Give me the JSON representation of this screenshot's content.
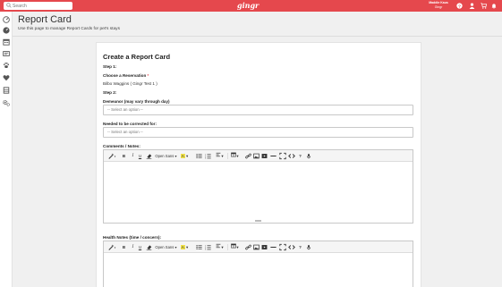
{
  "topbar": {
    "search_placeholder": "Search",
    "logo": "gingr",
    "user_name": "Maddie Kaus",
    "user_org": "Gingr"
  },
  "sidebar": {
    "icons": [
      "dashboard-icon",
      "gauge-icon",
      "calendar-icon",
      "id-card-icon",
      "paw-icon",
      "heart-icon",
      "book-icon",
      "gears-icon"
    ]
  },
  "header": {
    "title": "Report Card",
    "subtitle": "Use this page to manage Report Cards for pet's stays"
  },
  "form": {
    "title": "Create a Report Card",
    "step1": "Step 1:",
    "choose_label": "Choose a Reservation",
    "required_mark": "*",
    "reservation_value": "Bilbo Waggins ( Gingr Test 1 )",
    "step2": "Step 2:",
    "demeanor_label": "Demeanor (may vary through day)",
    "demeanor_placeholder": "-- Select an option --",
    "corrected_label": "Needed to be corrected for:",
    "corrected_placeholder": "-- Select an option --",
    "comments_label": "Comments / Notes:",
    "health_label": "Health Notes (time / concern):"
  },
  "editor_toolbar": {
    "bold": "B",
    "italic": "I",
    "underline": "U",
    "font_name": "Open Sans",
    "color_glyph": "A",
    "help": "?"
  },
  "colors": {
    "brand": "#e5484d",
    "text": "#333333"
  }
}
